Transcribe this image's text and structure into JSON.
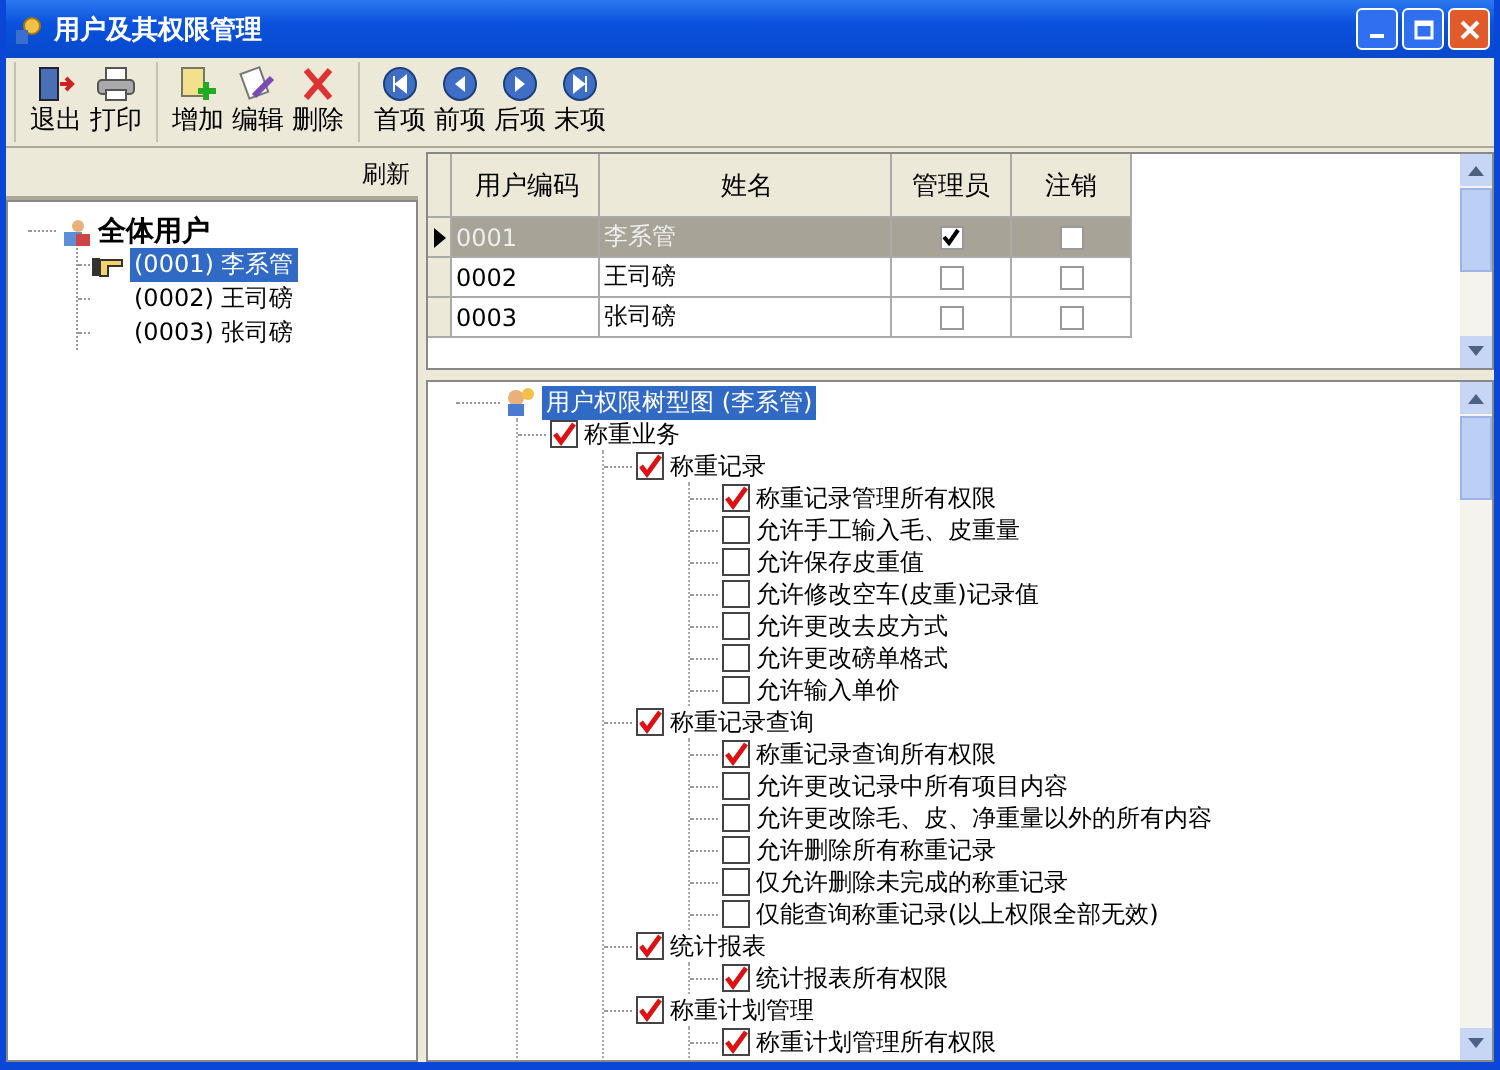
{
  "window": {
    "title": "用户及其权限管理"
  },
  "toolbar": {
    "groups": [
      [
        {
          "label": "退出",
          "kind": "exit"
        },
        {
          "label": "打印",
          "kind": "print"
        }
      ],
      [
        {
          "label": "增加",
          "kind": "add"
        },
        {
          "label": "编辑",
          "kind": "edit"
        },
        {
          "label": "删除",
          "kind": "delete"
        }
      ],
      [
        {
          "label": "首项",
          "kind": "first"
        },
        {
          "label": "前项",
          "kind": "prev"
        },
        {
          "label": "后项",
          "kind": "next"
        },
        {
          "label": "末项",
          "kind": "last"
        }
      ]
    ]
  },
  "user_panel": {
    "refresh": "刷新",
    "root": "全体用户",
    "users": [
      {
        "label": "(0001) 李系管",
        "selected": true
      },
      {
        "label": "(0002) 王司磅",
        "selected": false
      },
      {
        "label": "(0003) 张司磅",
        "selected": false
      }
    ]
  },
  "table": {
    "columns": [
      "用户编码",
      "姓名",
      "管理员",
      "注销"
    ],
    "rows": [
      {
        "code": "0001",
        "name": "李系管",
        "admin": true,
        "cancelled": false,
        "selected": true
      },
      {
        "code": "0002",
        "name": "王司磅",
        "admin": false,
        "cancelled": false,
        "selected": false
      },
      {
        "code": "0003",
        "name": "张司磅",
        "admin": false,
        "cancelled": false,
        "selected": false
      }
    ]
  },
  "permission_tree": {
    "root": "用户权限树型图 (李系管)",
    "root_selected": true,
    "children": [
      {
        "label": "称重业务",
        "checked": true,
        "children": [
          {
            "label": "称重记录",
            "checked": true,
            "children": [
              {
                "label": "称重记录管理所有权限",
                "checked": true
              },
              {
                "label": "允许手工输入毛、皮重量",
                "checked": false
              },
              {
                "label": "允许保存皮重值",
                "checked": false
              },
              {
                "label": "允许修改空车(皮重)记录值",
                "checked": false
              },
              {
                "label": "允许更改去皮方式",
                "checked": false
              },
              {
                "label": "允许更改磅单格式",
                "checked": false
              },
              {
                "label": "允许输入单价",
                "checked": false
              }
            ]
          },
          {
            "label": "称重记录查询",
            "checked": true,
            "children": [
              {
                "label": "称重记录查询所有权限",
                "checked": true
              },
              {
                "label": "允许更改记录中所有项目内容",
                "checked": false
              },
              {
                "label": "允许更改除毛、皮、净重量以外的所有内容",
                "checked": false
              },
              {
                "label": "允许删除所有称重记录",
                "checked": false
              },
              {
                "label": "仅允许删除未完成的称重记录",
                "checked": false
              },
              {
                "label": "仅能查询称重记录(以上权限全部无效)",
                "checked": false
              }
            ]
          },
          {
            "label": "统计报表",
            "checked": true,
            "children": [
              {
                "label": "统计报表所有权限",
                "checked": true
              }
            ]
          },
          {
            "label": "称重计划管理",
            "checked": true,
            "children": [
              {
                "label": "称重计划管理所有权限",
                "checked": true
              }
            ]
          }
        ]
      }
    ]
  }
}
